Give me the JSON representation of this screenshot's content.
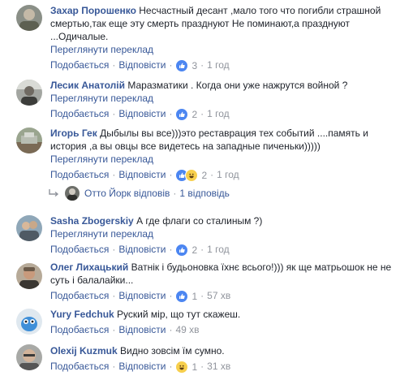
{
  "ui": {
    "translate_label": "Переглянути переклад",
    "like_label": "Подобається",
    "reply_label": "Відповісти",
    "dot": "·"
  },
  "comments": [
    {
      "author": "Захар Порошенко",
      "text": "Несчастный десант ,мало того что погибли страшной смертью,так еще эту смерть празднуют Не поминают,а празднуют ...Одичалые.",
      "reaction_count": "3",
      "time": "1 год"
    },
    {
      "author": "Лесик Анатолій",
      "text": "Маразматики . Когда они уже нажрутся войной ?",
      "reaction_count": "2",
      "time": "1 год"
    },
    {
      "author": "Игорь Гек",
      "text": "Дыбылы вы все)))это реставрация тех событий ....память и история ,а вы овцы все видетесь на западные пиченьки)))))",
      "reaction_count": "2",
      "time": "1 год"
    },
    {
      "author": "Sasha Zbogerskiy",
      "text": "А где флаги со сталиным ?)",
      "reaction_count": "2",
      "time": "1 год"
    },
    {
      "author": "Олег Лихацький",
      "text": "Ватнік і будьоновка їхнє всього!))) як ще матрьошок не не суть і балалайки...",
      "reaction_count": "1",
      "time": "57 хв"
    },
    {
      "author": "Yury Fedchuk",
      "text": "Руский мір, що тут скажеш.",
      "time": "49 хв"
    },
    {
      "author": "Olexij Kuzmuk",
      "text": "Видно зовсім їм сумно.",
      "reaction_count": "1",
      "time": "31 хв"
    }
  ],
  "replies_line": {
    "name": "Отто Йорк",
    "verb": "відповів",
    "count": "1 відповідь"
  },
  "colors": {
    "link": "#385898",
    "meta": "#90949c",
    "like": "#4c86f1",
    "haha": "#f7cf4d"
  }
}
